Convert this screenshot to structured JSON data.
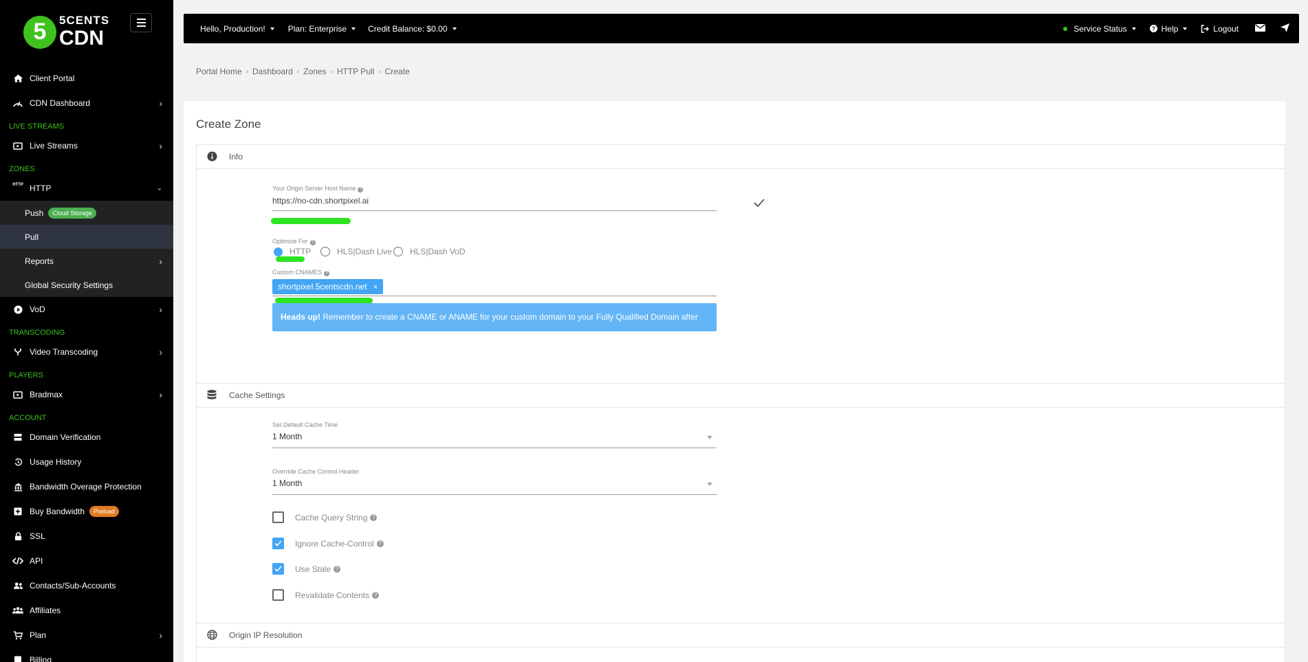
{
  "brand": {
    "logo_digit": "5",
    "logo_line1": "5CENTS",
    "logo_line2": "CDN",
    "accent": "#3fc21d"
  },
  "sidebar": {
    "items": [
      {
        "label": "Client Portal",
        "icon": "home-icon"
      },
      {
        "label": "CDN Dashboard",
        "icon": "speedometer-icon"
      }
    ],
    "section_live": "LIVE STREAMS",
    "live_streams": "Live Streams",
    "section_zones": "ZONES",
    "http": "HTTP",
    "http_icon_text": "HTTP",
    "push": "Push",
    "push_badge": "Cloud Storage",
    "pull": "Pull",
    "reports": "Reports",
    "global_security": "Global Security Settings",
    "vod": "VoD",
    "section_transcoding": "TRANSCODING",
    "video_transcoding": "Video Transcoding",
    "section_players": "PLAYERS",
    "bradmax": "Bradmax",
    "section_account": "ACCOUNT",
    "domain_verification": "Domain Verification",
    "usage_history": "Usage History",
    "bandwidth_overage": "Bandwidth Overage Protection",
    "buy_bandwidth": "Buy Bandwidth",
    "buy_badge": "Preload",
    "ssl": "SSL",
    "api": "API",
    "contacts": "Contacts/Sub-Accounts",
    "affiliates": "Affiliates",
    "plan": "Plan",
    "billing": "Billing"
  },
  "topbar": {
    "greeting": "Hello, Production!",
    "plan": "Plan: Enterprise",
    "credit": "Credit Balance: $0.00",
    "service_status": "Service Status",
    "help": "Help",
    "logout": "Logout"
  },
  "breadcrumb": [
    "Portal Home",
    "Dashboard",
    "Zones",
    "HTTP Pull",
    "Create"
  ],
  "page": {
    "title": "Create Zone",
    "info_section": "Info",
    "origin_label": "Your Origin Server Host Name",
    "origin_value": "https://no-cdn.shortpixel.ai",
    "optimize_label": "Optimize For",
    "optimize_options": [
      "HTTP",
      "HLS|Dash Live",
      "HLS|Dash VoD"
    ],
    "cnames_label": "Custom CNAMES",
    "cname_chip": "shortpixel.5centscdn.net",
    "chip_remove": "×",
    "alert_bold": "Heads up!",
    "alert_text": " Remember to create a CNAME or ANAME for your custom domain to your Fully Qualified Domain after creation.",
    "cache_section": "Cache Settings",
    "default_cache_label": "Set Default Cache Time",
    "default_cache_value": "1 Month",
    "override_label": "Override Cache Control Header",
    "override_value": "1 Month",
    "checkboxes": [
      {
        "label": "Cache Query String",
        "checked": false
      },
      {
        "label": "Ignore Cache-Control",
        "checked": true
      },
      {
        "label": "Use Stale",
        "checked": true
      },
      {
        "label": "Revalidate Contents",
        "checked": false
      }
    ],
    "origin_ip_section": "Origin IP Resolution",
    "help_mark": "?"
  }
}
